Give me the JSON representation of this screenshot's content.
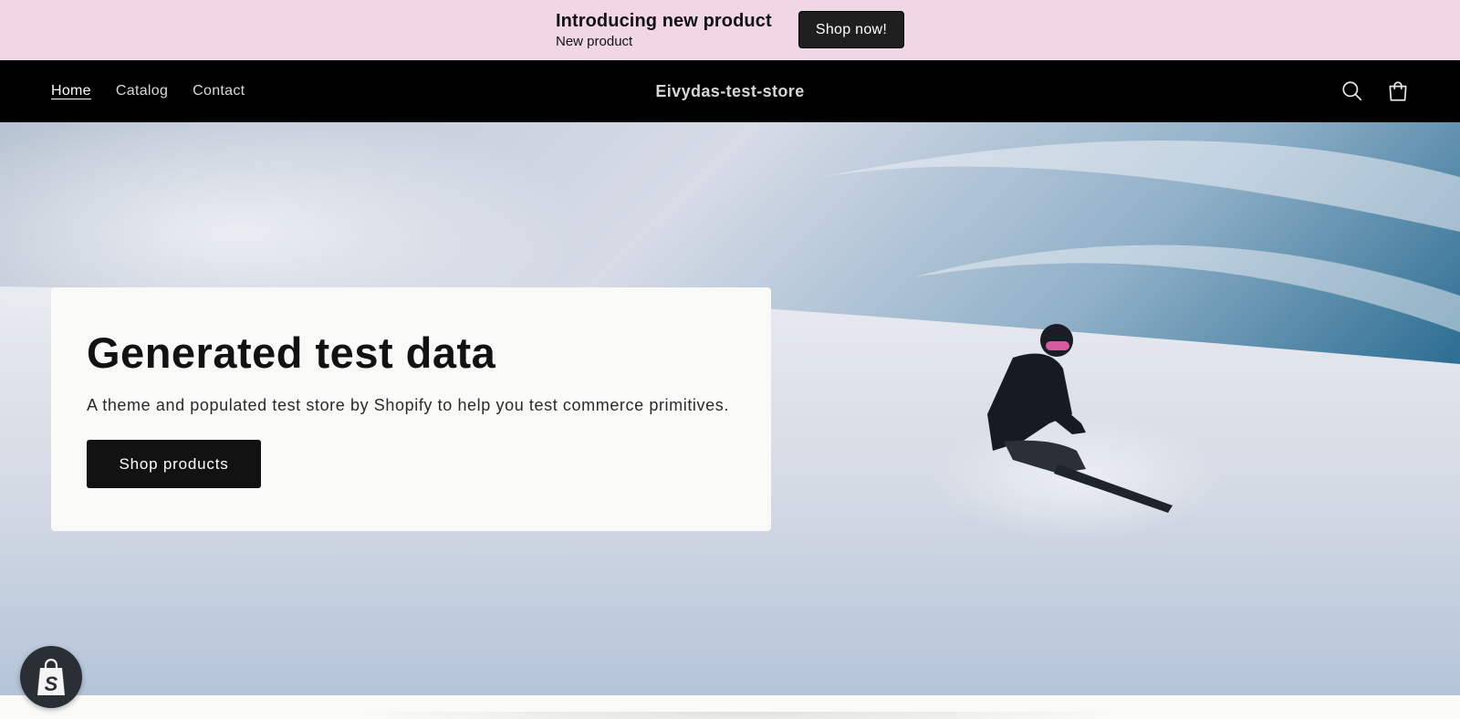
{
  "announcement": {
    "title": "Introducing new product",
    "subtitle": "New product",
    "button_label": "Shop now!"
  },
  "header": {
    "nav": [
      {
        "label": "Home",
        "active": true
      },
      {
        "label": "Catalog",
        "active": false
      },
      {
        "label": "Contact",
        "active": false
      }
    ],
    "store_name": "Eivydas-test-store",
    "icons": [
      "search-icon",
      "cart-icon"
    ]
  },
  "hero": {
    "title": "Generated test data",
    "subtitle": "A theme and populated test store by Shopify to help you test commerce primitives.",
    "button_label": "Shop products"
  },
  "badge": {
    "icon": "shopify-bag-icon"
  },
  "colors": {
    "announcement_bg": "#f1d7e5",
    "header_bg": "#000000",
    "button_bg": "#121212",
    "card_bg": "#f9f9f7"
  }
}
